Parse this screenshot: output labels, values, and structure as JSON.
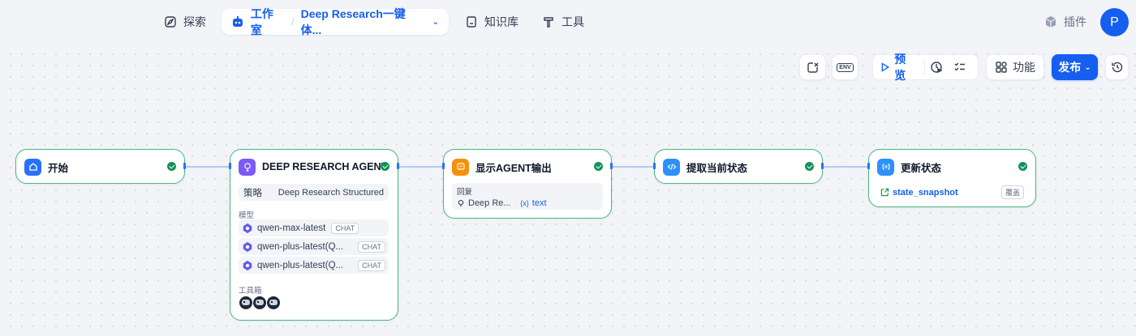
{
  "nav": {
    "explore": "探索",
    "studio": "工作室",
    "app_name": "Deep Research一键体...",
    "knowledge": "知识库",
    "tools": "工具",
    "plugins": "插件",
    "avatar_initial": "P"
  },
  "toolbar": {
    "env": "ENV",
    "preview": "预览",
    "features": "功能",
    "publish": "发布"
  },
  "nodes": {
    "start": {
      "title": "开始"
    },
    "agent": {
      "title": "DEEP RESEARCH AGENT",
      "strategy_label": "策略",
      "strategy_value": "Deep Research Structured",
      "model_label": "模型",
      "models": [
        {
          "name": "qwen-max-latest",
          "badge": "CHAT"
        },
        {
          "name": "qwen-plus-latest(Q...",
          "badge": "CHAT"
        },
        {
          "name": "qwen-plus-latest(Q...",
          "badge": "CHAT"
        }
      ],
      "toolbox_label": "工具箱"
    },
    "answer": {
      "title": "显示AGENT输出",
      "reply_label": "回复",
      "source": "Deep Re...",
      "var_prefix": "{x}",
      "var": "text"
    },
    "extract": {
      "title": "提取当前状态"
    },
    "update": {
      "title": "更新状态",
      "var": "state_snapshot",
      "mode": "覆盖"
    }
  },
  "colors": {
    "accent": "#155eef",
    "success": "#12915a",
    "node_border": "#47b881"
  }
}
